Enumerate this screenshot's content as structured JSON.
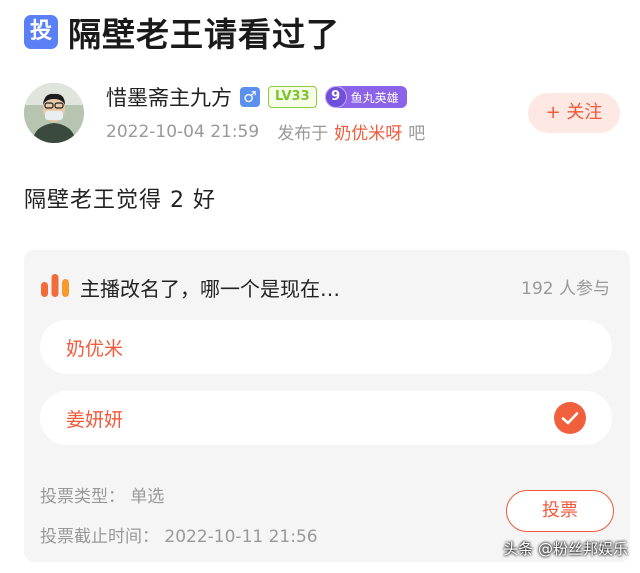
{
  "post": {
    "badge": "投",
    "title": "隔壁老王请看过了",
    "text": "隔壁老王觉得 2 好"
  },
  "author": {
    "name": "惜墨斋主九方",
    "gender_symbol": "♂",
    "level": "LV33",
    "fan_level": "9",
    "fan_title": "鱼丸英雄",
    "time": "2022-10-04 21:59",
    "posted_in": "发布于",
    "bar_name": "奶优米呀",
    "bar_suffix": "吧",
    "follow_label": "+ 关注"
  },
  "poll": {
    "question": "主播改名了，哪一个是现在…",
    "participants": "192 人参与",
    "options": [
      {
        "label": "奶优米",
        "selected": false
      },
      {
        "label": "姜妍妍",
        "selected": true
      }
    ],
    "type_label": "投票类型：",
    "type_value": "单选",
    "deadline_label": "投票截止时间：",
    "deadline_value": "2022-10-11 21:56",
    "vote_label": "投票"
  },
  "watermark": "头条 @粉丝邦娱乐",
  "colors": {
    "accent": "#f05a3b",
    "badge_blue": "#5b7ff5",
    "level_green": "#7cc52a",
    "fan_purple": "#8a63e8"
  }
}
